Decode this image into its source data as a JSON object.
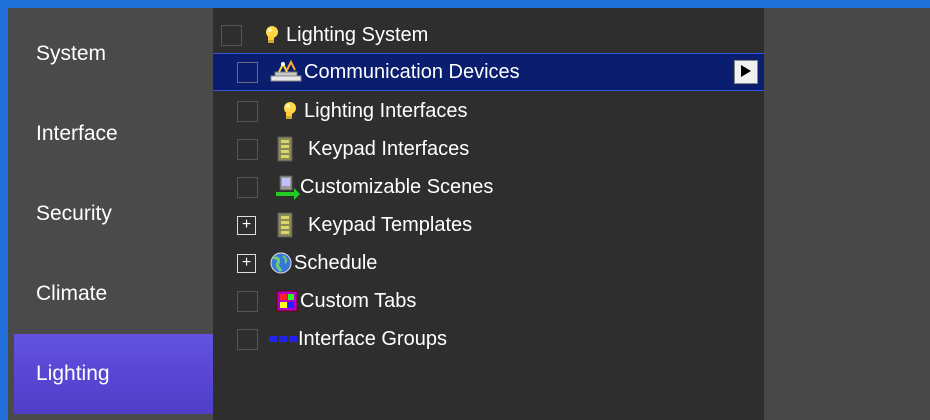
{
  "sidebar": {
    "items": [
      {
        "label": "System",
        "icon": "system"
      },
      {
        "label": "Interface",
        "icon": "interface"
      },
      {
        "label": "Security",
        "icon": "security"
      },
      {
        "label": "Climate",
        "icon": "climate"
      },
      {
        "label": "Lighting",
        "icon": "lighting",
        "active": true
      }
    ]
  },
  "tree": {
    "root": {
      "label": "Lighting System",
      "icon": "light-bulb-icon"
    },
    "items": [
      {
        "label": "Communication Devices",
        "icon": "communication-device-icon",
        "selected": true
      },
      {
        "label": "Lighting Interfaces",
        "icon": "light-bulb-icon"
      },
      {
        "label": "Keypad Interfaces",
        "icon": "keypad-icon"
      },
      {
        "label": "Customizable Scenes",
        "icon": "scene-icon"
      },
      {
        "label": "Keypad Templates",
        "icon": "keypad-icon",
        "expandable": true,
        "expander": "+"
      },
      {
        "label": "Schedule",
        "icon": "globe-icon",
        "expandable": true,
        "expander": "+"
      },
      {
        "label": "Custom Tabs",
        "icon": "custom-tabs-icon"
      },
      {
        "label": "Interface Groups",
        "icon": "interface-groups-icon"
      }
    ]
  },
  "colors": {
    "accent_border": "#1e6fd8",
    "active_tab": "#5b47d4",
    "selected_row": "#0b1d6e"
  }
}
